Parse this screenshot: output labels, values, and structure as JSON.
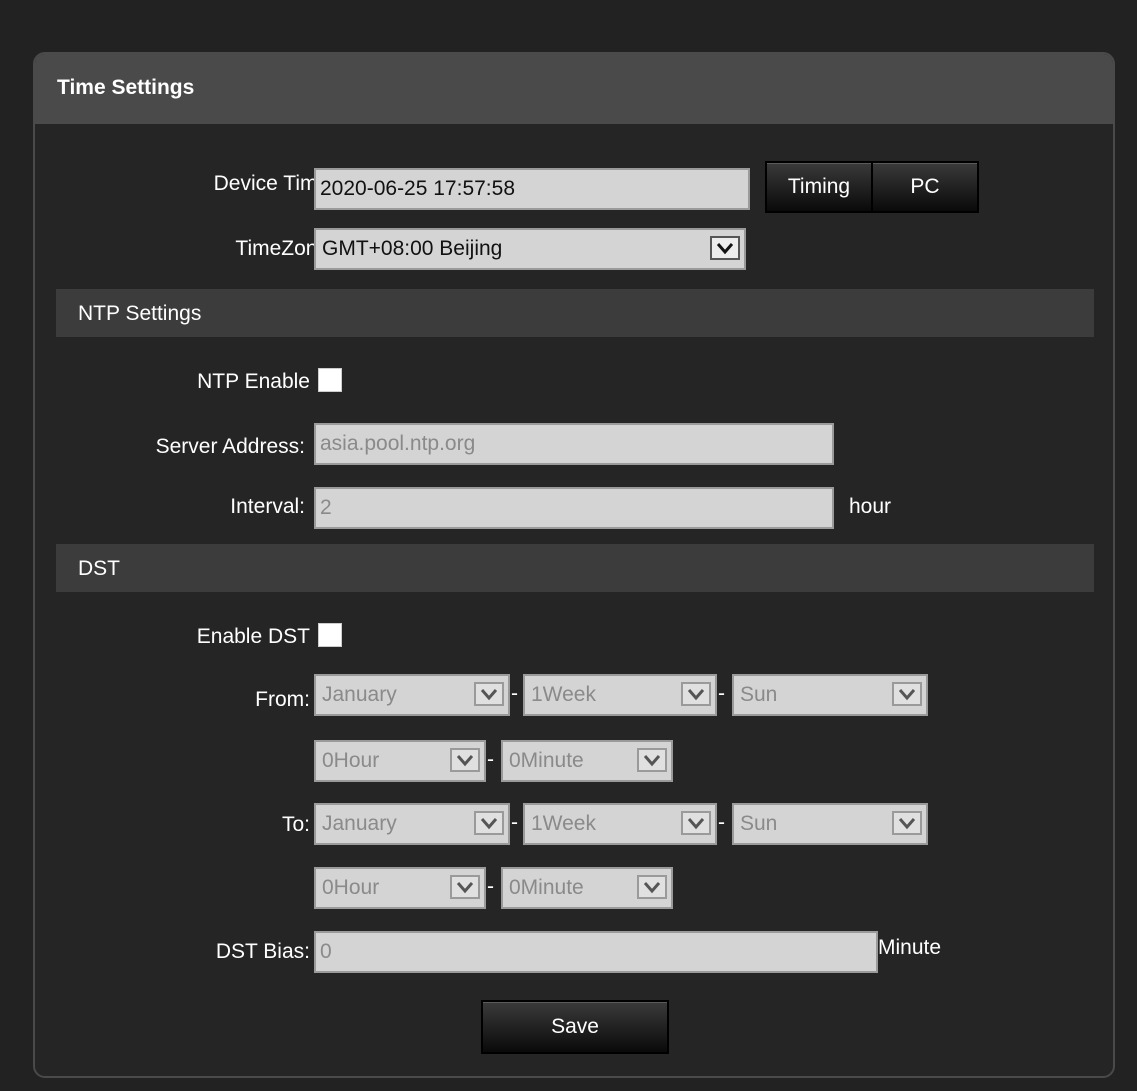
{
  "panel": {
    "title": "Time Settings"
  },
  "device_time": {
    "label": "Device Time:",
    "value": "2020-06-25 17:57:58",
    "timing_button": "Timing",
    "pc_button": "PC"
  },
  "timezone": {
    "label": "TimeZone:",
    "selected": "GMT+08:00 Beijing"
  },
  "ntp": {
    "section_title": "NTP Settings",
    "enable_label": "NTP Enable",
    "enabled": false,
    "server_label": "Server Address:",
    "server_value": "asia.pool.ntp.org",
    "interval_label": "Interval:",
    "interval_value": "2",
    "interval_unit": "hour"
  },
  "dst": {
    "section_title": "DST",
    "enable_label": "Enable DST",
    "enabled": false,
    "from_label": "From:",
    "to_label": "To:",
    "dash": "-",
    "from": {
      "month": "January",
      "week": "1Week",
      "day": "Sun",
      "hour": "0Hour",
      "minute": "0Minute"
    },
    "to": {
      "month": "January",
      "week": "1Week",
      "day": "Sun",
      "hour": "0Hour",
      "minute": "0Minute"
    },
    "bias_label": "DST Bias:",
    "bias_value": "0",
    "bias_unit": "Minute"
  },
  "save_button": "Save",
  "icons": {
    "dropdown": "chevron-down-icon"
  }
}
